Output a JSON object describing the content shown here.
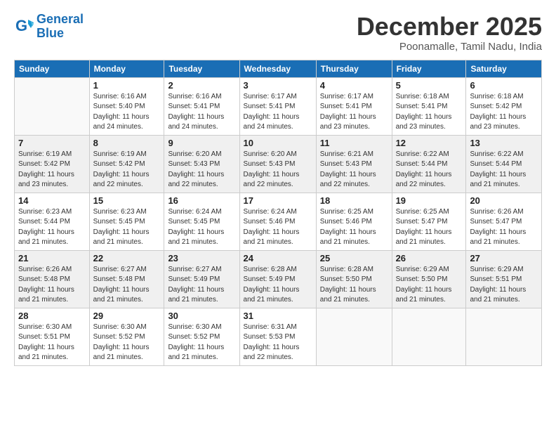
{
  "logo": {
    "line1": "General",
    "line2": "Blue"
  },
  "title": "December 2025",
  "subtitle": "Poonamalle, Tamil Nadu, India",
  "headers": [
    "Sunday",
    "Monday",
    "Tuesday",
    "Wednesday",
    "Thursday",
    "Friday",
    "Saturday"
  ],
  "weeks": [
    [
      {
        "day": "",
        "info": ""
      },
      {
        "day": "1",
        "info": "Sunrise: 6:16 AM\nSunset: 5:40 PM\nDaylight: 11 hours\nand 24 minutes."
      },
      {
        "day": "2",
        "info": "Sunrise: 6:16 AM\nSunset: 5:41 PM\nDaylight: 11 hours\nand 24 minutes."
      },
      {
        "day": "3",
        "info": "Sunrise: 6:17 AM\nSunset: 5:41 PM\nDaylight: 11 hours\nand 24 minutes."
      },
      {
        "day": "4",
        "info": "Sunrise: 6:17 AM\nSunset: 5:41 PM\nDaylight: 11 hours\nand 23 minutes."
      },
      {
        "day": "5",
        "info": "Sunrise: 6:18 AM\nSunset: 5:41 PM\nDaylight: 11 hours\nand 23 minutes."
      },
      {
        "day": "6",
        "info": "Sunrise: 6:18 AM\nSunset: 5:42 PM\nDaylight: 11 hours\nand 23 minutes."
      }
    ],
    [
      {
        "day": "7",
        "info": "Sunrise: 6:19 AM\nSunset: 5:42 PM\nDaylight: 11 hours\nand 23 minutes."
      },
      {
        "day": "8",
        "info": "Sunrise: 6:19 AM\nSunset: 5:42 PM\nDaylight: 11 hours\nand 22 minutes."
      },
      {
        "day": "9",
        "info": "Sunrise: 6:20 AM\nSunset: 5:43 PM\nDaylight: 11 hours\nand 22 minutes."
      },
      {
        "day": "10",
        "info": "Sunrise: 6:20 AM\nSunset: 5:43 PM\nDaylight: 11 hours\nand 22 minutes."
      },
      {
        "day": "11",
        "info": "Sunrise: 6:21 AM\nSunset: 5:43 PM\nDaylight: 11 hours\nand 22 minutes."
      },
      {
        "day": "12",
        "info": "Sunrise: 6:22 AM\nSunset: 5:44 PM\nDaylight: 11 hours\nand 22 minutes."
      },
      {
        "day": "13",
        "info": "Sunrise: 6:22 AM\nSunset: 5:44 PM\nDaylight: 11 hours\nand 21 minutes."
      }
    ],
    [
      {
        "day": "14",
        "info": "Sunrise: 6:23 AM\nSunset: 5:44 PM\nDaylight: 11 hours\nand 21 minutes."
      },
      {
        "day": "15",
        "info": "Sunrise: 6:23 AM\nSunset: 5:45 PM\nDaylight: 11 hours\nand 21 minutes."
      },
      {
        "day": "16",
        "info": "Sunrise: 6:24 AM\nSunset: 5:45 PM\nDaylight: 11 hours\nand 21 minutes."
      },
      {
        "day": "17",
        "info": "Sunrise: 6:24 AM\nSunset: 5:46 PM\nDaylight: 11 hours\nand 21 minutes."
      },
      {
        "day": "18",
        "info": "Sunrise: 6:25 AM\nSunset: 5:46 PM\nDaylight: 11 hours\nand 21 minutes."
      },
      {
        "day": "19",
        "info": "Sunrise: 6:25 AM\nSunset: 5:47 PM\nDaylight: 11 hours\nand 21 minutes."
      },
      {
        "day": "20",
        "info": "Sunrise: 6:26 AM\nSunset: 5:47 PM\nDaylight: 11 hours\nand 21 minutes."
      }
    ],
    [
      {
        "day": "21",
        "info": "Sunrise: 6:26 AM\nSunset: 5:48 PM\nDaylight: 11 hours\nand 21 minutes."
      },
      {
        "day": "22",
        "info": "Sunrise: 6:27 AM\nSunset: 5:48 PM\nDaylight: 11 hours\nand 21 minutes."
      },
      {
        "day": "23",
        "info": "Sunrise: 6:27 AM\nSunset: 5:49 PM\nDaylight: 11 hours\nand 21 minutes."
      },
      {
        "day": "24",
        "info": "Sunrise: 6:28 AM\nSunset: 5:49 PM\nDaylight: 11 hours\nand 21 minutes."
      },
      {
        "day": "25",
        "info": "Sunrise: 6:28 AM\nSunset: 5:50 PM\nDaylight: 11 hours\nand 21 minutes."
      },
      {
        "day": "26",
        "info": "Sunrise: 6:29 AM\nSunset: 5:50 PM\nDaylight: 11 hours\nand 21 minutes."
      },
      {
        "day": "27",
        "info": "Sunrise: 6:29 AM\nSunset: 5:51 PM\nDaylight: 11 hours\nand 21 minutes."
      }
    ],
    [
      {
        "day": "28",
        "info": "Sunrise: 6:30 AM\nSunset: 5:51 PM\nDaylight: 11 hours\nand 21 minutes."
      },
      {
        "day": "29",
        "info": "Sunrise: 6:30 AM\nSunset: 5:52 PM\nDaylight: 11 hours\nand 21 minutes."
      },
      {
        "day": "30",
        "info": "Sunrise: 6:30 AM\nSunset: 5:52 PM\nDaylight: 11 hours\nand 21 minutes."
      },
      {
        "day": "31",
        "info": "Sunrise: 6:31 AM\nSunset: 5:53 PM\nDaylight: 11 hours\nand 22 minutes."
      },
      {
        "day": "",
        "info": ""
      },
      {
        "day": "",
        "info": ""
      },
      {
        "day": "",
        "info": ""
      }
    ]
  ]
}
